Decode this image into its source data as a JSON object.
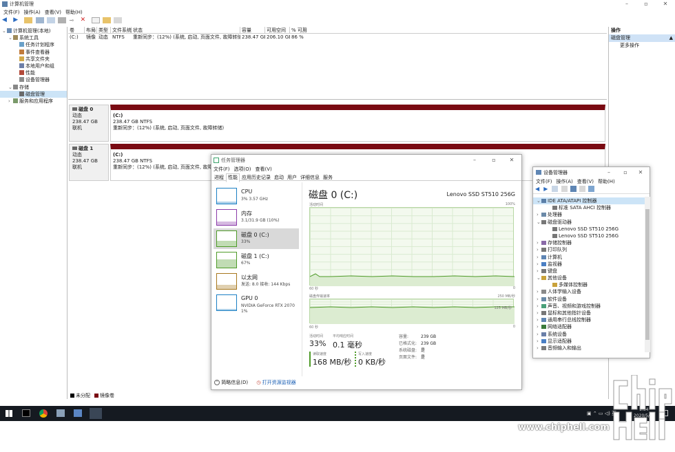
{
  "main": {
    "title": "计算机管理",
    "menu": [
      "文件(F)",
      "操作(A)",
      "查看(V)",
      "帮助(H)"
    ],
    "tree": [
      {
        "label": "计算机管理(本地)",
        "indent": 0
      },
      {
        "label": "系统工具",
        "indent": 1
      },
      {
        "label": "任务计划程序",
        "indent": 2
      },
      {
        "label": "事件查看器",
        "indent": 2
      },
      {
        "label": "共享文件夹",
        "indent": 2
      },
      {
        "label": "本地用户和组",
        "indent": 2
      },
      {
        "label": "性能",
        "indent": 2
      },
      {
        "label": "设备管理器",
        "indent": 2
      },
      {
        "label": "存储",
        "indent": 1
      },
      {
        "label": "磁盘管理",
        "indent": 2
      },
      {
        "label": "服务和应用程序",
        "indent": 1
      }
    ],
    "volume_headers": [
      "卷",
      "布局",
      "类型",
      "文件系统",
      "状态",
      "容量",
      "可用空间",
      "% 可用"
    ],
    "volume_row": [
      "(C:)",
      "镜像",
      "动态",
      "NTFS",
      "重新同步：(12%) (系统, 启动, 页面文件, 故障转储)",
      "238.47 GB",
      "206.10 GB",
      "86 %"
    ],
    "disks": [
      {
        "name": "磁盘 0",
        "type": "动态",
        "size": "238.47 GB",
        "status": "联机",
        "vol": "(C:)",
        "vol_size": "238.47 GB NTFS",
        "vol_status": "重新同步：(12%) (系统, 启动, 页面文件, 故障转储)"
      },
      {
        "name": "磁盘 1",
        "type": "动态",
        "size": "238.47 GB",
        "status": "联机",
        "vol": "(C:)",
        "vol_size": "238.47 GB NTFS",
        "vol_status": "重新同步：(12%) (系统, 启动, 页面文件, 故障转储)"
      }
    ],
    "legend": [
      "未分配",
      "镜像卷"
    ],
    "actions_title": "操作",
    "actions_section": "磁盘管理",
    "actions_more": "更多操作"
  },
  "taskmgr": {
    "title": "任务管理器",
    "menu": [
      "文件(F)",
      "选项(O)",
      "查看(V)"
    ],
    "tabs": [
      "进程",
      "性能",
      "应用历史记录",
      "启动",
      "用户",
      "详细信息",
      "服务"
    ],
    "cards": [
      {
        "title": "CPU",
        "sub": "3% 3.57 GHz",
        "color": "#1a7fc4"
      },
      {
        "title": "内存",
        "sub": "3.1/31.9 GB (10%)",
        "color": "#8a3aa8"
      },
      {
        "title": "磁盘 0 (C:)",
        "sub": "33%",
        "color": "#4d9a27"
      },
      {
        "title": "磁盘 1 (C:)",
        "sub": "67%",
        "color": "#4d9a27"
      },
      {
        "title": "以太网",
        "sub": "发送: 8.0 接收: 144 Kbps",
        "color": "#a7771d"
      },
      {
        "title": "GPU 0",
        "sub": "NVIDIA GeForce RTX 2070\n1%",
        "color": "#1a7fc4"
      }
    ],
    "heading": "磁盘 0 (C:)",
    "model": "Lenovo SSD ST510 256G",
    "graph1_label": "活动时间",
    "graph1_max": "100%",
    "graph1_time": "60 秒",
    "graph1_min": "0",
    "graph2_label": "磁盘传输速率",
    "graph2_max": "250 MB/秒",
    "graph2_mid": "125 MB/秒",
    "graph2_time": "60 秒",
    "graph2_min": "0",
    "stats": {
      "active_label": "活动时间",
      "active_value": "33%",
      "resp_label": "平均响应时间",
      "resp_value": "0.1 毫秒",
      "read_label": "读取速度",
      "read_value": "168 MB/秒",
      "write_label": "写入速度",
      "write_value": "0 KB/秒",
      "props": [
        [
          "容量:",
          "239 GB"
        ],
        [
          "已格式化:",
          "239 GB"
        ],
        [
          "系统磁盘:",
          "是"
        ],
        [
          "页面文件:",
          "是"
        ]
      ]
    },
    "footer_less": "简略信息(D)",
    "footer_monitor": "打开资源监视器"
  },
  "devmgr": {
    "title": "设备管理器",
    "menu": [
      "文件(F)",
      "操作(A)",
      "查看(V)",
      "帮助(H)"
    ],
    "items": [
      {
        "label": "IDE ATA/ATAPI 控制器",
        "indent": 1,
        "open": true,
        "sel": true
      },
      {
        "label": "标准 SATA AHCI 控制器",
        "indent": 2
      },
      {
        "label": "处理器",
        "indent": 1
      },
      {
        "label": "磁盘驱动器",
        "indent": 1,
        "open": true
      },
      {
        "label": "Lenovo SSD ST510 256G",
        "indent": 2
      },
      {
        "label": "Lenovo SSD ST510 256G",
        "indent": 2
      },
      {
        "label": "存储控制器",
        "indent": 1
      },
      {
        "label": "打印队列",
        "indent": 1
      },
      {
        "label": "计算机",
        "indent": 1
      },
      {
        "label": "监视器",
        "indent": 1
      },
      {
        "label": "键盘",
        "indent": 1
      },
      {
        "label": "其他设备",
        "indent": 1,
        "open": true
      },
      {
        "label": "多媒体控制器",
        "indent": 2
      },
      {
        "label": "人体学输入设备",
        "indent": 1
      },
      {
        "label": "软件设备",
        "indent": 1
      },
      {
        "label": "声音、视频和游戏控制器",
        "indent": 1
      },
      {
        "label": "鼠标和其他指针设备",
        "indent": 1
      },
      {
        "label": "通用串行总线控制器",
        "indent": 1
      },
      {
        "label": "网络适配器",
        "indent": 1
      },
      {
        "label": "系统设备",
        "indent": 1
      },
      {
        "label": "显示适配器",
        "indent": 1
      },
      {
        "label": "音频输入和输出",
        "indent": 1
      }
    ]
  },
  "taskbar": {
    "time": "1:34",
    "date": "2020/5/30"
  },
  "watermark": "www.chiphell.com"
}
